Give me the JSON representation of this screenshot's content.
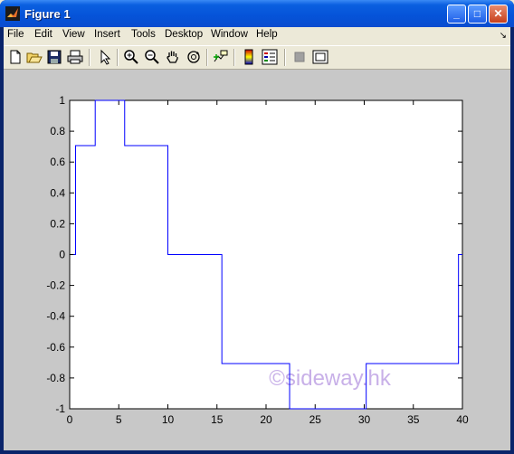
{
  "window": {
    "title": "Figure 1",
    "minimize_label": "_",
    "maximize_label": "□",
    "close_label": "✕"
  },
  "menu": {
    "items": [
      "File",
      "Edit",
      "View",
      "Insert",
      "Tools",
      "Desktop",
      "Window",
      "Help"
    ],
    "dock_arrow": "↘"
  },
  "toolbar": {
    "icons": [
      "new-figure-icon",
      "open-file-icon",
      "save-icon",
      "print-icon",
      "edit-plot-arrow-icon",
      "zoom-in-icon",
      "zoom-out-icon",
      "pan-hand-icon",
      "rotate-3d-icon",
      "data-cursor-icon",
      "colorbar-icon",
      "legend-icon",
      "hide-plot-tools-icon",
      "show-plot-tools-icon"
    ]
  },
  "colors": {
    "line": "#0000ff",
    "axes_bg": "#ffffff",
    "figure_bg": "#c8c8c8",
    "watermark": "#c8b0e8"
  },
  "watermark": "©sideway.hk",
  "chart_data": {
    "type": "line",
    "style": "stairs",
    "title": "",
    "xlabel": "",
    "ylabel": "",
    "xlim": [
      0,
      40
    ],
    "ylim": [
      -1,
      1
    ],
    "xticks": [
      "0",
      "5",
      "10",
      "15",
      "20",
      "25",
      "30",
      "35",
      "40"
    ],
    "yticks": [
      "1",
      "0.8",
      "0.6",
      "0.4",
      "0.2",
      "0",
      "-0.2",
      "-0.4",
      "-0.6",
      "-0.8",
      "-1"
    ],
    "grid": false,
    "series": [
      {
        "x": [
          0.4,
          0.6,
          2.6,
          5.6,
          10,
          15.5,
          22.4,
          30.2,
          39.6,
          40
        ],
        "y": [
          0,
          0.707,
          1,
          0.707,
          0,
          -0.707,
          -1,
          -0.707,
          0,
          0
        ]
      }
    ]
  }
}
